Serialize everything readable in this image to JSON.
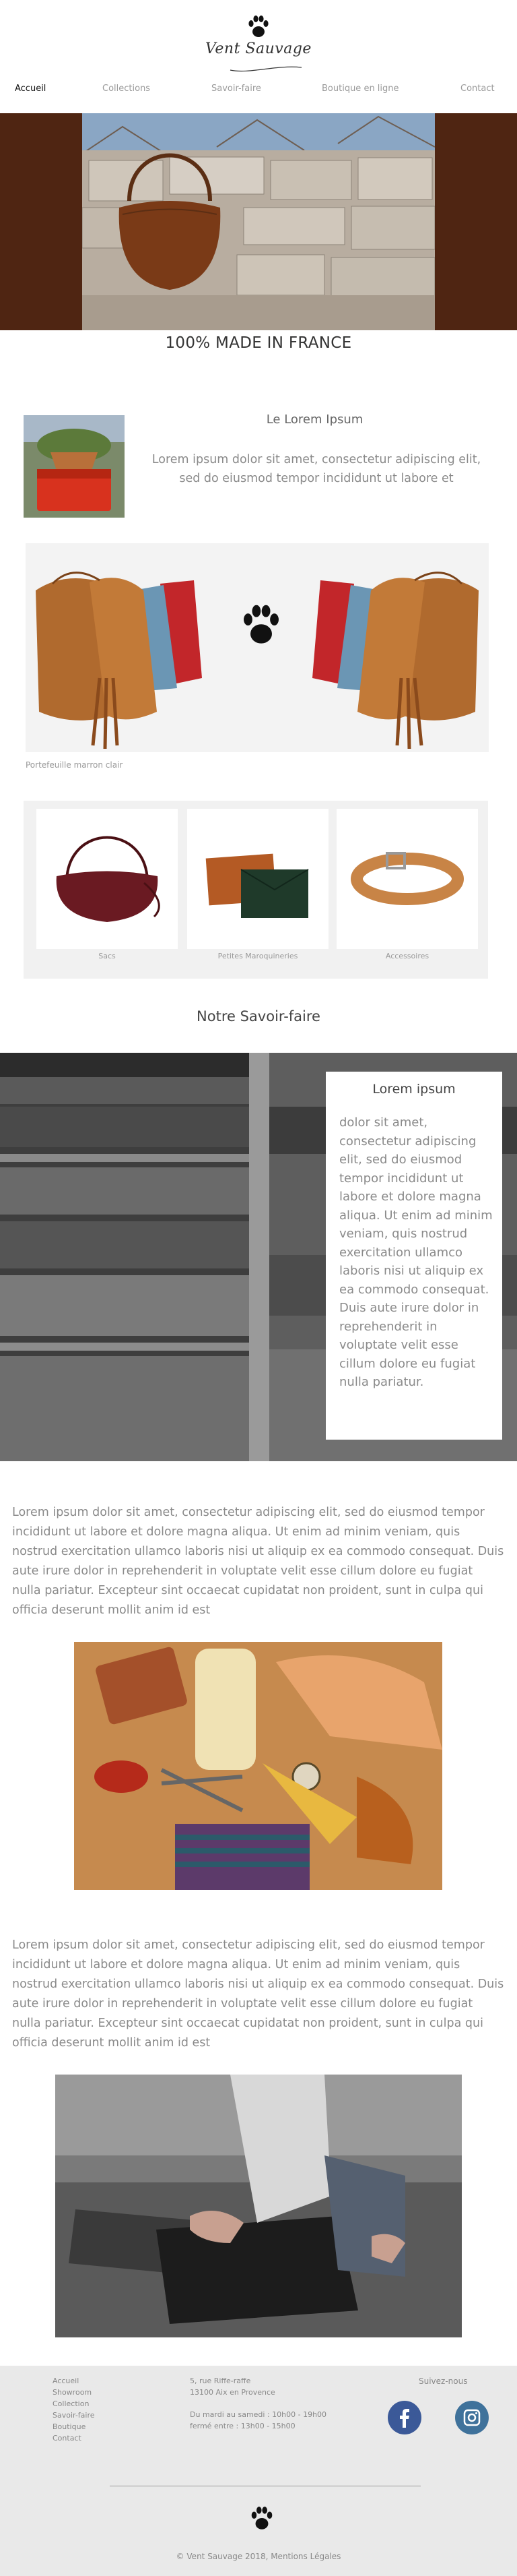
{
  "brand": {
    "logo_text": "Vent Sauvage"
  },
  "nav": {
    "items": [
      {
        "label": "Accueil",
        "active": true
      },
      {
        "label": "Collections",
        "active": false
      },
      {
        "label": "Savoir-faire",
        "active": false
      },
      {
        "label": "Boutique en ligne",
        "active": false
      },
      {
        "label": "Contact",
        "active": false
      }
    ]
  },
  "hero": {
    "tagline": "100% MADE IN FRANCE"
  },
  "intro": {
    "title": "Le Lorem Ipsum",
    "text": "Lorem ipsum dolor sit amet, consectetur adipiscing elit, sed do eiusmod tempor incididunt ut labore et"
  },
  "banner": {
    "caption": "Portefeuille marron clair"
  },
  "products": [
    {
      "label": "Sacs"
    },
    {
      "label": "Petites Maroquineries"
    },
    {
      "label": "Accessoires"
    }
  ],
  "savoir": {
    "title": "Notre Savoir-faire",
    "box_title": "Lorem ipsum",
    "box_text": "dolor sit amet, consectetur adipiscing elit, sed do eiusmod tempor incididunt ut labore et dolore magna aliqua. Ut enim ad minim veniam, quis nostrud exercitation ullamco laboris nisi ut aliquip ex ea commodo consequat. Duis aute irure dolor in reprehenderit in voluptate velit esse cillum dolore eu fugiat nulla pariatur."
  },
  "paragraphs": {
    "p1": "Lorem ipsum dolor sit amet, consectetur adipiscing elit, sed do eiusmod tempor incididunt ut labore et dolore magna aliqua. Ut enim ad minim veniam, quis nostrud exercitation ullamco laboris nisi ut aliquip ex ea commodo consequat. Duis aute irure dolor in reprehenderit in voluptate velit esse cillum dolore eu fugiat nulla pariatur. Excepteur sint occaecat cupidatat non proident, sunt in culpa qui officia deserunt mollit anim id est",
    "p2": "Lorem ipsum dolor sit amet, consectetur adipiscing elit, sed do eiusmod tempor incididunt ut labore et dolore magna aliqua. Ut enim ad minim veniam, quis nostrud exercitation ullamco laboris nisi ut aliquip ex ea commodo consequat. Duis aute irure dolor in reprehenderit in voluptate velit esse cillum dolore eu fugiat nulla pariatur. Excepteur sint occaecat cupidatat non proident, sunt in culpa qui officia deserunt mollit anim id est"
  },
  "footer": {
    "links": [
      "Accueil",
      "Showroom",
      "Collection",
      "Savoir-faire",
      "Boutique",
      "Contact"
    ],
    "address_1": "5, rue Riffe-raffe",
    "address_2": "13100 Aix en Provence",
    "hours_1": "Du mardi au samedi : 10h00 - 19h00",
    "hours_2": "fermé entre : 13h00 - 15h00",
    "follow": "Suivez-nous",
    "copyright": "© Vent Sauvage 2018, Mentions Légales"
  },
  "colors": {
    "hero_band": "#4f2512",
    "panel": "#f3f3f3",
    "footer_bg": "#e9e9e9",
    "facebook": "#3b5998",
    "instagram": "#3f729b"
  },
  "icons": [
    "paw-icon",
    "facebook-icon",
    "instagram-icon"
  ]
}
